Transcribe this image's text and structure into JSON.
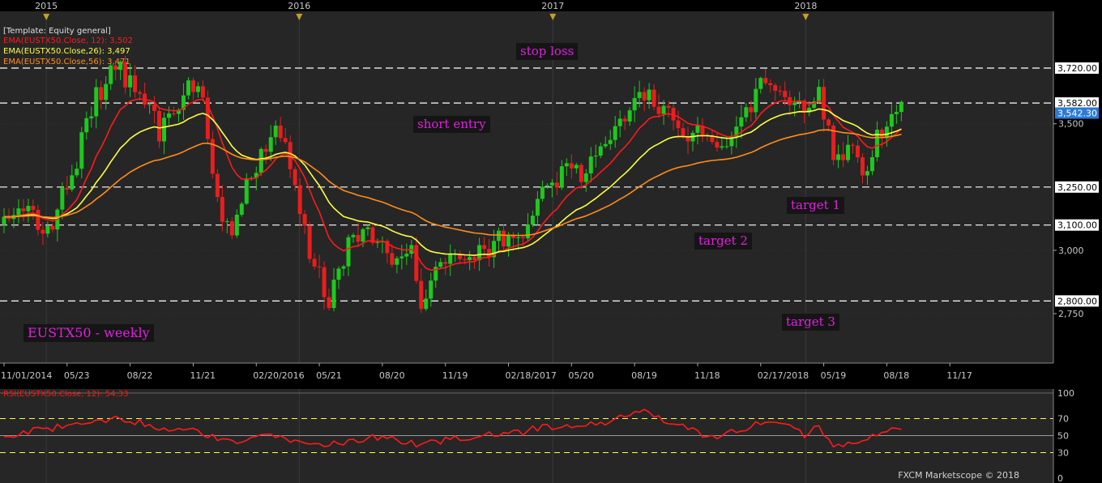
{
  "template_label": "[Template: Equity general]",
  "legend": [
    {
      "text": "EMA(EUSTX50.Close, 12): 3,502",
      "color": "#ff1a1a"
    },
    {
      "text": "EMA(EUSTX50.Close,26): 3,497",
      "color": "#ffff40"
    },
    {
      "text": "EMA(EUSTX50.Close,56): 3,471",
      "color": "#ff8c1a"
    }
  ],
  "rsi_label": "RSI(EUSTX50.Close, 12): 54.33",
  "copyright": "FXCM Marketscope © 2018",
  "annotations": {
    "stop_loss": "stop loss",
    "short_entry": "short entry",
    "target_1": "target 1",
    "target_2": "target 2",
    "target_3": "target 3",
    "instrument": "EUSTX50 - weekly"
  },
  "colors": {
    "up_candle": "#1ec81e",
    "down_candle": "#e81e1e",
    "ema12": "#ff1a1a",
    "ema26": "#ffff40",
    "ema56": "#ff8c1a",
    "rsi": "#ff1a1a",
    "current_price_badge": "#2d7ad6",
    "annotation_text": "#e020e0"
  },
  "chart_data": {
    "type": "candlestick",
    "symbol": "EUSTX50",
    "timeframe": "weekly",
    "x_range": [
      "2014-11-01",
      "2018-11-17"
    ],
    "ylim": [
      2580,
      3880
    ],
    "y_tick_labels": [
      "3,500",
      "3,000",
      "2,750"
    ],
    "year_labels": [
      "2015",
      "2016",
      "2017",
      "2018"
    ],
    "x_tick_labels": [
      "11/01/2014",
      "05/23",
      "08/22",
      "11/21",
      "02/20/2016",
      "05/21",
      "08/20",
      "11/19",
      "02/18/2017",
      "05/20",
      "08/19",
      "11/18",
      "02/17/2018",
      "05/19",
      "08/18",
      "11/17"
    ],
    "horizontal_levels": [
      {
        "value": 3720,
        "label": "3,720.00"
      },
      {
        "value": 3582,
        "label": "3,582.00"
      },
      {
        "value": 3250,
        "label": "3,250.00"
      },
      {
        "value": 3100,
        "label": "3,100.00"
      },
      {
        "value": 2800,
        "label": "2,800.00"
      }
    ],
    "current_price": {
      "value": 3542.3,
      "label": "3,542.30"
    },
    "price_anchors": [
      [
        "2014-11-01",
        3100
      ],
      [
        "2014-12-06",
        3140
      ],
      [
        "2015-01-03",
        3080
      ],
      [
        "2015-01-31",
        3250
      ],
      [
        "2015-03-14",
        3600
      ],
      [
        "2015-04-11",
        3720
      ],
      [
        "2015-05-16",
        3620
      ],
      [
        "2015-06-13",
        3470
      ],
      [
        "2015-06-27",
        3520
      ],
      [
        "2015-07-25",
        3660
      ],
      [
        "2015-08-15",
        3580
      ],
      [
        "2015-08-29",
        3260
      ],
      [
        "2015-09-26",
        3050
      ],
      [
        "2015-10-17",
        3250
      ],
      [
        "2015-11-14",
        3400
      ],
      [
        "2015-12-05",
        3480
      ],
      [
        "2015-12-26",
        3280
      ],
      [
        "2016-01-16",
        3000
      ],
      [
        "2016-02-13",
        2780
      ],
      [
        "2016-03-12",
        3030
      ],
      [
        "2016-04-16",
        3060
      ],
      [
        "2016-05-14",
        2950
      ],
      [
        "2016-06-11",
        3000
      ],
      [
        "2016-06-25",
        2790
      ],
      [
        "2016-07-16",
        2950
      ],
      [
        "2016-08-20",
        3000
      ],
      [
        "2016-09-24",
        3000
      ],
      [
        "2016-10-22",
        3060
      ],
      [
        "2016-11-19",
        3040
      ],
      [
        "2016-12-10",
        3220
      ],
      [
        "2017-01-21",
        3310
      ],
      [
        "2017-02-18",
        3300
      ],
      [
        "2017-03-25",
        3450
      ],
      [
        "2017-04-29",
        3560
      ],
      [
        "2017-05-13",
        3630
      ],
      [
        "2017-06-10",
        3560
      ],
      [
        "2017-07-08",
        3480
      ],
      [
        "2017-08-05",
        3450
      ],
      [
        "2017-08-26",
        3400
      ],
      [
        "2017-09-23",
        3500
      ],
      [
        "2017-10-21",
        3600
      ],
      [
        "2017-11-04",
        3680
      ],
      [
        "2017-12-02",
        3570
      ],
      [
        "2017-12-30",
        3560
      ],
      [
        "2018-01-20",
        3640
      ],
      [
        "2018-02-10",
        3400
      ],
      [
        "2018-03-10",
        3400
      ],
      [
        "2018-03-24",
        3300
      ],
      [
        "2018-04-14",
        3440
      ],
      [
        "2018-05-05",
        3540
      ],
      [
        "2018-05-19",
        3542
      ]
    ],
    "ema_last_values": {
      "ema12": 3502,
      "ema26": 3497,
      "ema56": 3471
    },
    "rsi": {
      "period": 12,
      "last_value": 54.33,
      "levels": [
        70,
        50,
        30
      ],
      "axis_labels": [
        "100",
        "70",
        "50",
        "30",
        "0"
      ],
      "anchors": [
        [
          "2014-11-01",
          48
        ],
        [
          "2014-12-20",
          58
        ],
        [
          "2015-02-14",
          62
        ],
        [
          "2015-04-18",
          72
        ],
        [
          "2015-06-13",
          58
        ],
        [
          "2015-08-01",
          60
        ],
        [
          "2015-09-12",
          42
        ],
        [
          "2015-11-21",
          52
        ],
        [
          "2016-01-23",
          38
        ],
        [
          "2016-03-19",
          45
        ],
        [
          "2016-05-07",
          48
        ],
        [
          "2016-06-25",
          40
        ],
        [
          "2016-08-27",
          48
        ],
        [
          "2016-10-29",
          52
        ],
        [
          "2016-12-24",
          60
        ],
        [
          "2017-03-04",
          62
        ],
        [
          "2017-05-13",
          78
        ],
        [
          "2017-06-24",
          62
        ],
        [
          "2017-08-26",
          48
        ],
        [
          "2017-10-21",
          62
        ],
        [
          "2017-11-11",
          70
        ],
        [
          "2017-12-30",
          52
        ],
        [
          "2018-01-20",
          60
        ],
        [
          "2018-02-10",
          38
        ],
        [
          "2018-03-24",
          42
        ],
        [
          "2018-04-28",
          55
        ],
        [
          "2018-05-19",
          54.33
        ]
      ]
    }
  }
}
